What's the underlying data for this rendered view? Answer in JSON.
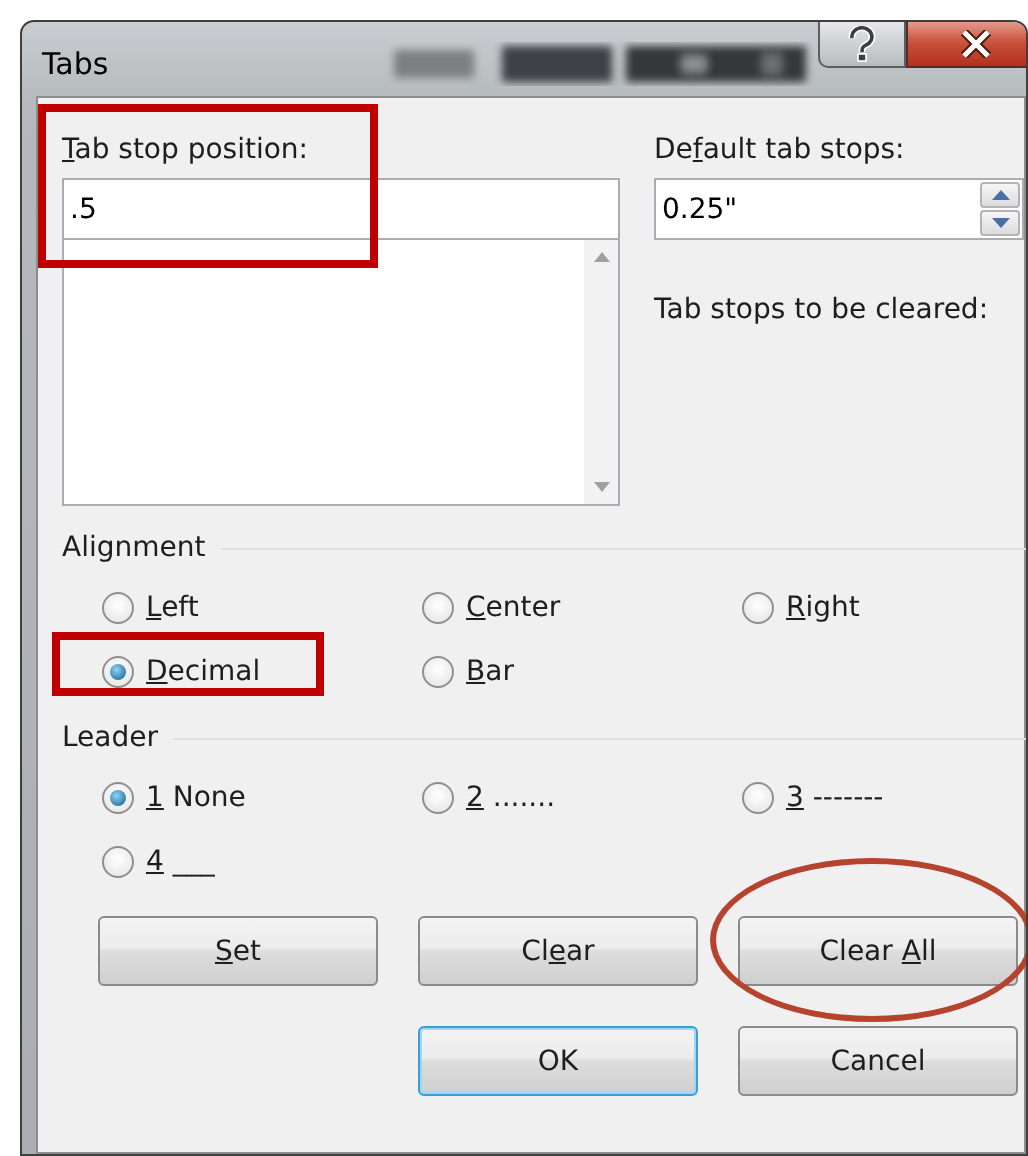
{
  "window": {
    "title": "Tabs"
  },
  "tab_stop_position": {
    "label": {
      "key": "T",
      "after": "ab stop position:"
    },
    "value": ".5",
    "boxed": true
  },
  "default_tab_stops": {
    "label": {
      "before": "De",
      "key": "f",
      "after": "ault tab stops:"
    },
    "value": "0.25\""
  },
  "tab_stops_to_be_cleared": {
    "label": "Tab stops to be cleared:"
  },
  "alignment": {
    "label": "Alignment",
    "options": [
      {
        "label": {
          "key": "L",
          "after": "eft"
        },
        "selected": false,
        "boxed": false
      },
      {
        "label": {
          "key": "C",
          "after": "enter"
        },
        "selected": false,
        "boxed": false
      },
      {
        "label": {
          "key": "R",
          "after": "ight"
        },
        "selected": false,
        "boxed": false
      },
      {
        "label": {
          "key": "D",
          "after": "ecimal"
        },
        "selected": true,
        "boxed": true
      },
      {
        "label": {
          "key": "B",
          "after": "ar"
        },
        "selected": false,
        "boxed": false
      }
    ]
  },
  "leader": {
    "label": "Leader",
    "options": [
      {
        "label": {
          "key": "1",
          "after": " None"
        },
        "selected": true
      },
      {
        "label": {
          "key": "2",
          "after": " ......."
        },
        "selected": false
      },
      {
        "label": {
          "key": "3",
          "after": " -------"
        },
        "selected": false
      },
      {
        "label": {
          "key": "4",
          "after": " ___"
        },
        "selected": false
      }
    ]
  },
  "buttons": [
    {
      "label": {
        "key": "S",
        "after": "et"
      },
      "circled": false
    },
    {
      "label": {
        "before": "Cl",
        "key": "e",
        "after": "ar"
      },
      "circled": false
    },
    {
      "label": {
        "before": "Clear ",
        "key": "A",
        "after": "ll"
      },
      "circled": true
    }
  ],
  "dialog_buttons": [
    {
      "label": "OK",
      "default": true
    },
    {
      "label": "Cancel",
      "default": false
    }
  ]
}
